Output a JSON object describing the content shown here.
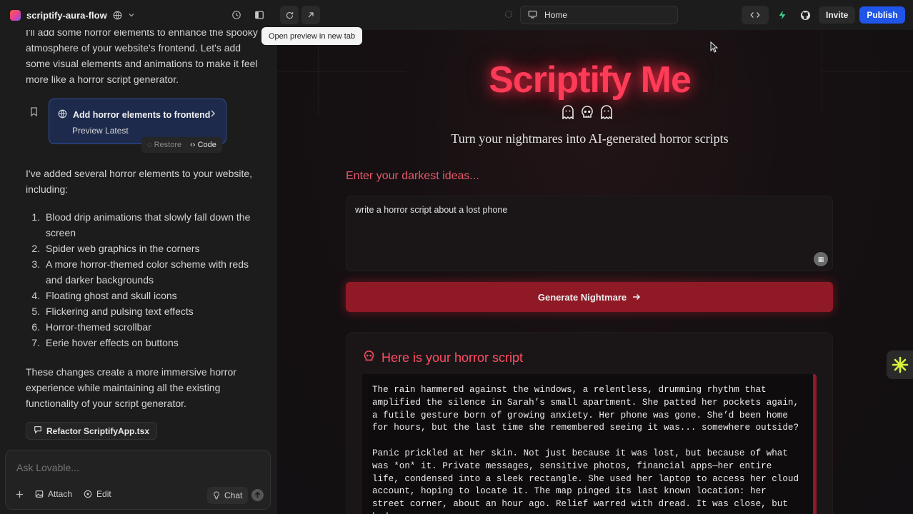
{
  "topbar": {
    "project_name": "scriptify-aura-flow",
    "url_label": "Home",
    "invite_label": "Invite",
    "publish_label": "Publish"
  },
  "tooltip": "Open preview in new tab",
  "chat": {
    "intro": "I'll add some horror elements to enhance the spooky atmosphere of your website's frontend. Let's add some visual elements and animations to make it feel more like a horror script generator.",
    "card": {
      "title": "Add horror elements to frontend",
      "subtitle": "Preview Latest",
      "restore_label": "Restore",
      "code_label": "Code"
    },
    "summary": "I've added several horror elements to your website, including:",
    "list": [
      {
        "n": "1.",
        "text": "Blood drip animations that slowly fall down the screen"
      },
      {
        "n": "2.",
        "text": "Spider web graphics in the corners"
      },
      {
        "n": "3.",
        "text": "A more horror-themed color scheme with reds and darker backgrounds"
      },
      {
        "n": "4.",
        "text": "Floating ghost and skull icons"
      },
      {
        "n": "5.",
        "text": "Flickering and pulsing text effects"
      },
      {
        "n": "6.",
        "text": "Horror-themed scrollbar"
      },
      {
        "n": "7.",
        "text": "Eerie hover effects on buttons"
      }
    ],
    "closing": "These changes create a more immersive horror experience while maintaining all the existing functionality of your script generator.",
    "refactor_label": "Refactor ScriptifyApp.tsx"
  },
  "composer": {
    "placeholder": "Ask Lovable...",
    "attach_label": "Attach",
    "edit_label": "Edit",
    "chat_label": "Chat"
  },
  "preview": {
    "hero_title": "Scriptify Me",
    "tagline": "Turn your nightmares into AI-generated horror scripts",
    "ideas_label": "Enter your darkest ideas...",
    "prompt_value": "write a horror script about a lost phone",
    "generate_label": "Generate Nightmare",
    "result_title": "Here is your horror script",
    "script_p1": "The rain hammered against the windows, a relentless, drumming rhythm that amplified the silence in Sarah’s small apartment. She patted her pockets again, a futile gesture born of growing anxiety. Her phone was gone. She’d been home for hours, but the last time she remembered seeing it was... somewhere outside?",
    "script_p2": "Panic prickled at her skin. Not just because it was lost, but because of what was *on* it. Private messages, sensitive photos, financial apps—her entire life, condensed into a sleek rectangle. She used her laptop to access her cloud account, hoping to locate it. The map pinged its last known location: her street corner, about an hour ago. Relief warred with dread. It was close, but had"
  },
  "colors": {
    "accent_red": "#ff3b57",
    "button_red": "#8f1a26",
    "publish_blue": "#1f55e8",
    "card_blue": "#1d2a4c"
  }
}
